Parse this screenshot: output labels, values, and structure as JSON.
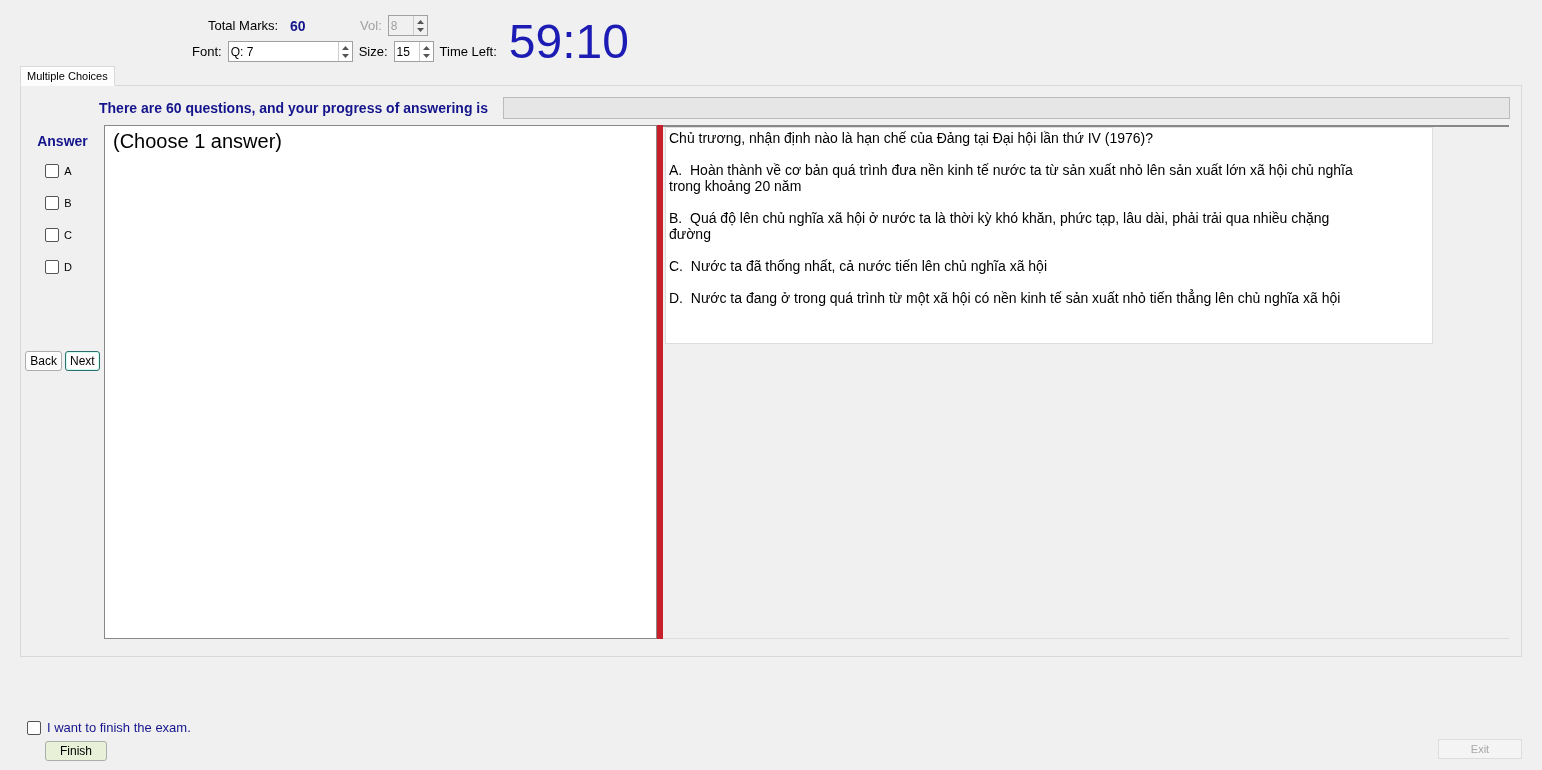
{
  "header": {
    "total_marks_label": "Total Marks:",
    "total_marks": "60",
    "vol": {
      "label": "Vol:",
      "value": "8",
      "disabled": true
    },
    "font": {
      "label": "Font:",
      "value": "Q: 7"
    },
    "size": {
      "label": "Size:",
      "value": "15"
    },
    "time_left_label": "Time Left:",
    "time_left": "59:10"
  },
  "tabs": [
    {
      "label": "Multiple Choices",
      "selected": true
    }
  ],
  "progress": {
    "label": "There are 60 questions, and your progress of answering is",
    "level": 0
  },
  "answer": {
    "title": "Answer",
    "options": [
      {
        "label": "A",
        "checked": false
      },
      {
        "label": "B",
        "checked": false
      },
      {
        "label": "C",
        "checked": false
      },
      {
        "label": "D",
        "checked": false
      }
    ]
  },
  "nav_buttons": [
    {
      "label": "Back",
      "focused": false
    },
    {
      "label": "Next",
      "focused": true
    }
  ],
  "answer_note": "(Choose 1 answer)",
  "question": {
    "text": "Chủ trương, nhận định nào là hạn chế của Đảng tại Đại hội lần thứ IV (1976)?",
    "choices": [
      "A.  Hoàn thành về cơ bản quá trình đưa nền kinh tế nước ta từ sản xuất nhỏ lên sản xuất lớn xã hội chủ nghĩa trong khoảng 20 năm",
      "B.  Quá độ lên chủ nghĩa xã hội ở nước ta là thời kỳ khó khăn, phức tạp, lâu dài, phải trải qua nhiều chặng đường",
      "C.  Nước ta đã thống nhất, cả nước tiến lên chủ nghĩa xã hội",
      "D.  Nước ta đang ở trong quá trình từ một xã hội có nền kinh tế sản xuất nhỏ tiến thẳng lên chủ nghĩa xã hội"
    ]
  },
  "finish": {
    "label": "I want to finish the exam.",
    "checked": false,
    "button": "Finish"
  },
  "exit": {
    "label": "Exit",
    "disabled": true
  }
}
